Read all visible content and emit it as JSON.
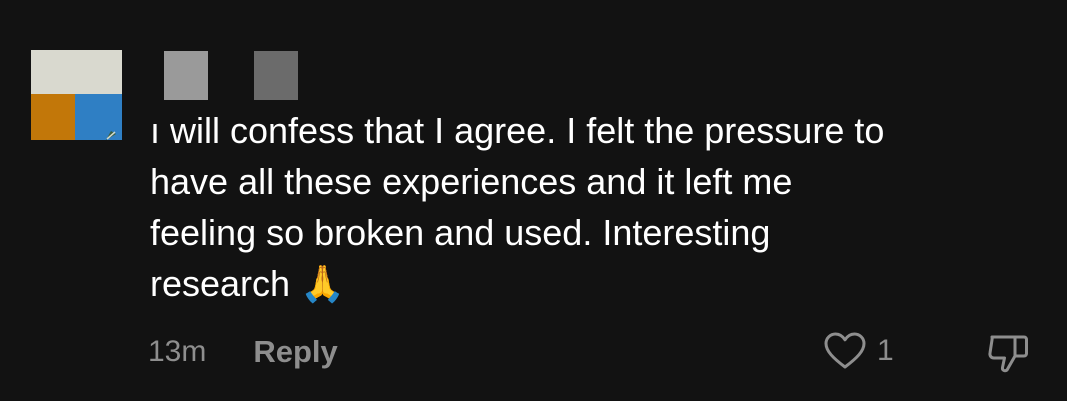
{
  "comment": {
    "text": "ı will confess that I agree. I felt the pressure to\nhave all these experiences and it left me\nfeeling so broken and used. Interesting\nresearch 🙏",
    "timestamp": "13m",
    "reply_label": "Reply",
    "like_count": "1",
    "icons": {
      "like": "heart-outline-icon",
      "dislike": "thumbs-down-outline-icon"
    }
  },
  "colors": {
    "background": "#121212",
    "text": "#ffffff",
    "muted": "#8e8e8e"
  }
}
